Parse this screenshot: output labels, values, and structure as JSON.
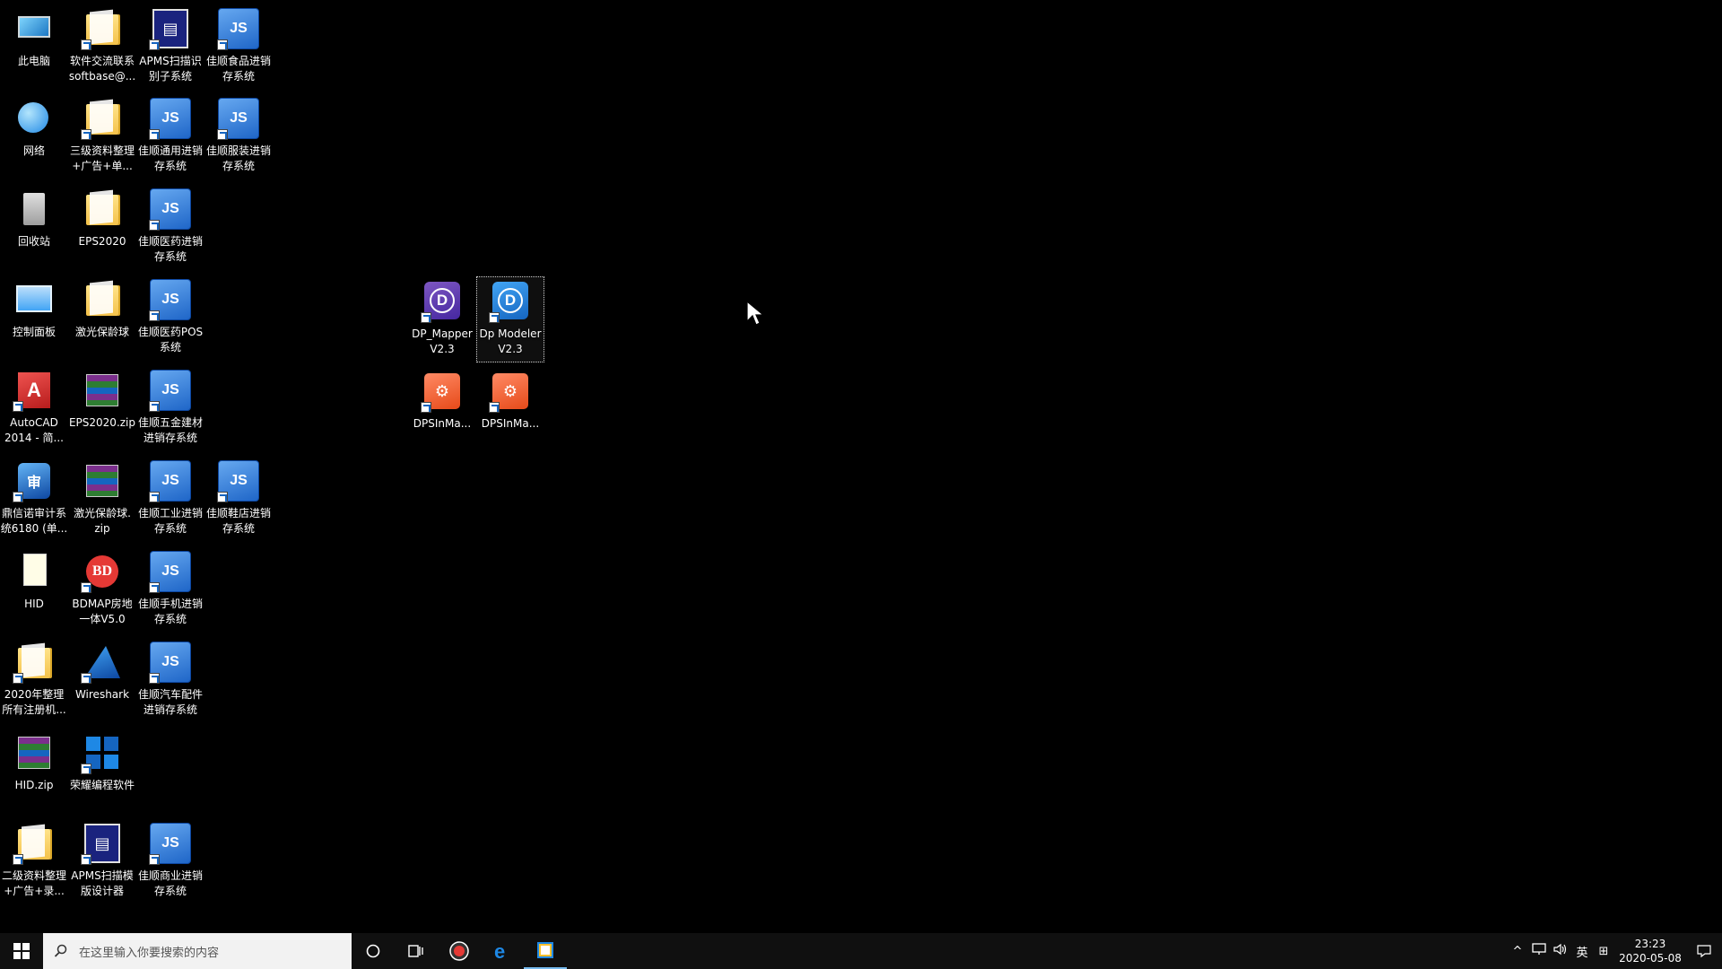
{
  "desktop": {
    "icons": [
      {
        "label": "此电脑"
      },
      {
        "label": "软件交流联系\nsoftbase@..."
      },
      {
        "label": "APMS扫描识\n别子系统"
      },
      {
        "label": "佳顺食品进销\n存系统"
      },
      {
        "label": "网络"
      },
      {
        "label": "三级资料整理\n+广告+单..."
      },
      {
        "label": "佳顺通用进销\n存系统"
      },
      {
        "label": "佳顺服装进销\n存系统"
      },
      {
        "label": "回收站"
      },
      {
        "label": "EPS2020"
      },
      {
        "label": "佳顺医药进销\n存系统"
      },
      {
        "label": "控制面板"
      },
      {
        "label": "激光保龄球"
      },
      {
        "label": "佳顺医药POS\n系统"
      },
      {
        "label": "AutoCAD\n2014 - 简..."
      },
      {
        "label": "EPS2020.zip"
      },
      {
        "label": "佳顺五金建材\n进销存系统"
      },
      {
        "label": "鼎信诺审计系\n统6180 (单..."
      },
      {
        "label": "激光保龄球.\nzip"
      },
      {
        "label": "佳顺工业进销\n存系统"
      },
      {
        "label": "佳顺鞋店进销\n存系统"
      },
      {
        "label": "HID"
      },
      {
        "label": "BDMAP房地\n一体V5.0"
      },
      {
        "label": "佳顺手机进销\n存系统"
      },
      {
        "label": "2020年整理\n所有注册机..."
      },
      {
        "label": "Wireshark"
      },
      {
        "label": "佳顺汽车配件\n进销存系统"
      },
      {
        "label": "HID.zip"
      },
      {
        "label": "荣耀编程软件"
      },
      {
        "label": "二级资料整理\n+广告+录..."
      },
      {
        "label": "APMS扫描模\n版设计器"
      },
      {
        "label": "佳顺商业进销\n存系统"
      },
      {
        "label": "DP_Mapper\nV2.3"
      },
      {
        "label": "Dp Modeler\nV2.3"
      },
      {
        "label": "DPSInMa..."
      },
      {
        "label": "DPSInMa..."
      }
    ],
    "icon_glyphs": {
      "js": "JS",
      "acad": "A",
      "audit": "审",
      "bd": "BD",
      "dp": "D",
      "dps": "⚙",
      "scan": "▤"
    }
  },
  "taskbar": {
    "start_icon": "windows-logo",
    "search_placeholder": "在这里输入你要搜索的内容",
    "apps": [
      "cortana",
      "task-view",
      "screen-recorder",
      "edge",
      "app-manager"
    ],
    "tray": {
      "chevron": "^",
      "network": "network-icon",
      "volume": "volume-icon",
      "ime": "英",
      "ime_mode": "⊞",
      "time": "23:23",
      "date": "2020-05-08"
    }
  },
  "colors": {
    "taskbar_bg": "#101010",
    "accent": "#76b9ed",
    "desktop_bg": "#000000"
  }
}
